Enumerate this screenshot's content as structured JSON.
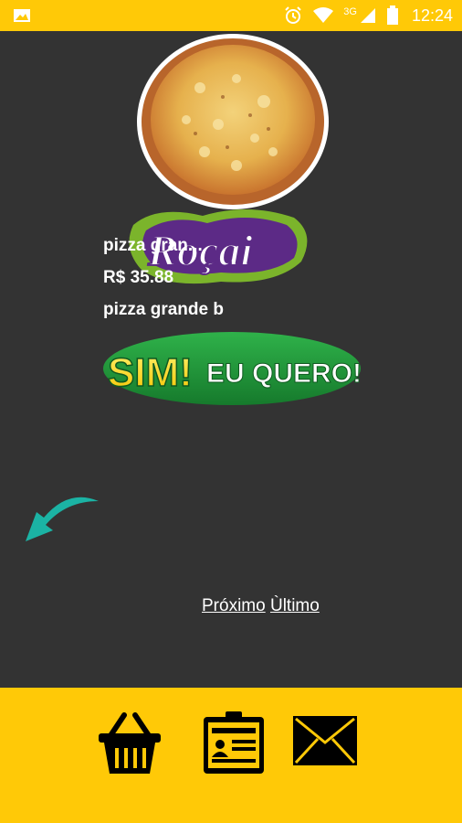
{
  "status_bar": {
    "network": "3G",
    "time": "12:24",
    "icons": [
      "image-icon",
      "alarm-icon",
      "wifi-icon",
      "signal-icon",
      "battery-icon"
    ]
  },
  "product": {
    "name": "pizza gran...",
    "price": "R$ 35.88",
    "description": "pizza grande b"
  },
  "logo_text": "Roçai",
  "cta": {
    "part1": "SIM!",
    "part2": "EU QUERO!"
  },
  "pagination": {
    "next_label": "Próximo",
    "last_label": "Ùltimo"
  },
  "bottom_nav": {
    "items": [
      "basket-icon",
      "contact-card-icon",
      "mail-icon"
    ]
  },
  "colors": {
    "accent_yellow": "#FFC907",
    "background": "#333333",
    "cta_green": "#1E9A3A",
    "arrow_teal": "#1BB3A4"
  }
}
